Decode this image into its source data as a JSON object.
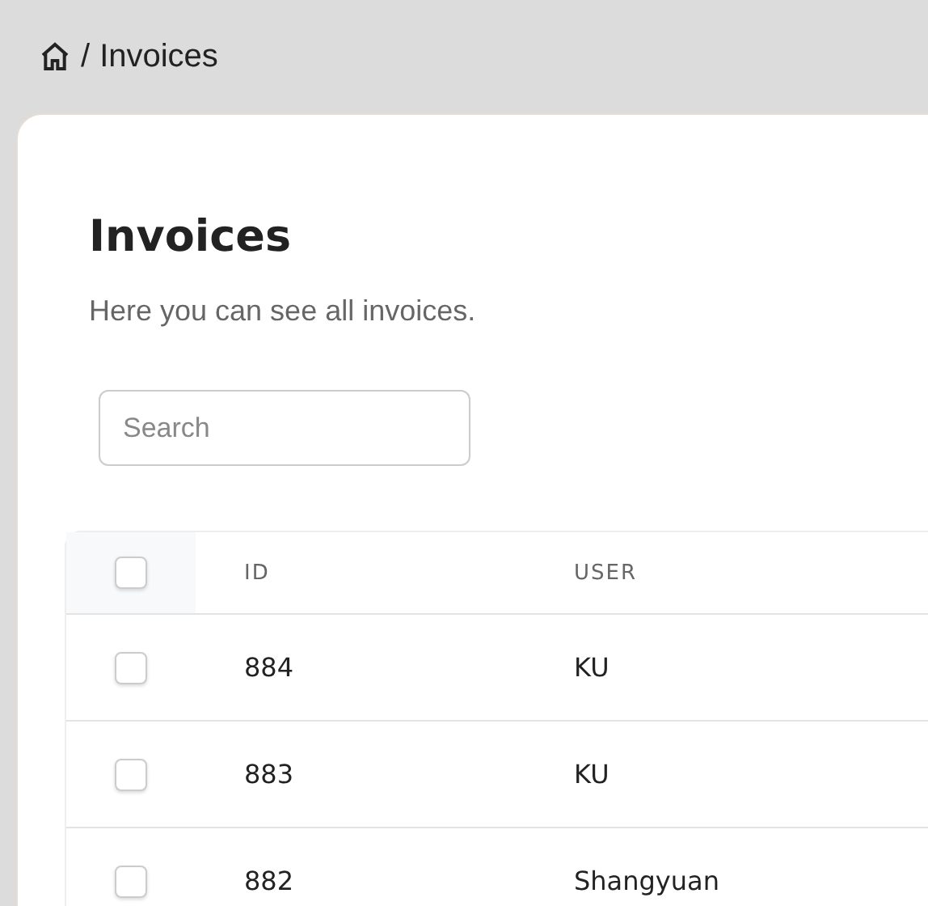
{
  "breadcrumb": {
    "separator": "/",
    "current": "Invoices"
  },
  "page": {
    "title": "Invoices",
    "subtitle": "Here you can see all invoices."
  },
  "search": {
    "placeholder": "Search"
  },
  "table": {
    "select_all": {
      "checked": false
    },
    "columns": [
      "ID",
      "USER"
    ],
    "rows": [
      {
        "checked": false,
        "cells": [
          "884",
          "KU"
        ]
      },
      {
        "checked": false,
        "cells": [
          "883",
          "KU"
        ]
      },
      {
        "checked": false,
        "cells": [
          "882",
          "Shangyuan"
        ]
      }
    ]
  }
}
